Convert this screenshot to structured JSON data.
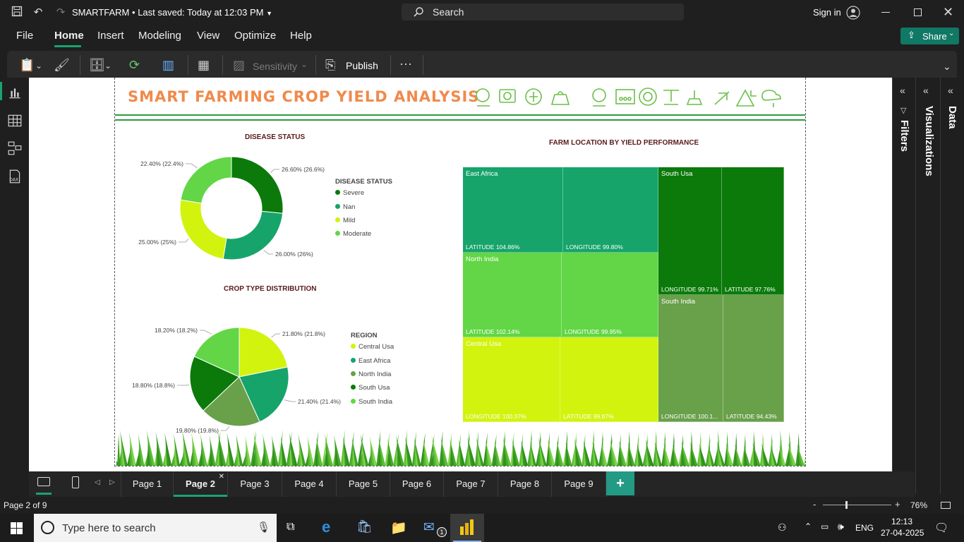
{
  "window": {
    "doc_title": "SMARTFARM",
    "saved_status": "Last saved: Today at 12:03 PM",
    "search_label": "Search",
    "signin_label": "Sign in"
  },
  "menu": {
    "items": [
      "File",
      "Home",
      "Insert",
      "Modeling",
      "View",
      "Optimize",
      "Help"
    ],
    "share_label": "Share"
  },
  "ribbon": {
    "sensitivity_label": "Sensitivity",
    "publish_label": "Publish",
    "more_label": "···"
  },
  "panes": {
    "filters": "Filters",
    "visualizations": "Visualizations",
    "data": "Data"
  },
  "report": {
    "title": "SMART FARMING CROP YIELD ANALYSIS",
    "disease": {
      "title": "DISEASE STATUS",
      "legend_title": "DISEASE STATUS",
      "slices": [
        {
          "name": "Severe",
          "value": 26.6,
          "label": "26.60% (26.6%)",
          "color": "#0b7a0b"
        },
        {
          "name": "Nan",
          "value": 26.0,
          "label": "26.00% (26%)",
          "color": "#16a46a"
        },
        {
          "name": "Mild",
          "value": 25.0,
          "label": "25.00% (25%)",
          "color": "#d2f30e"
        },
        {
          "name": "Moderate",
          "value": 22.4,
          "label": "22.40% (22.4%)",
          "color": "#62d646"
        }
      ]
    },
    "crop": {
      "title": "CROP TYPE DISTRIBUTION",
      "legend_title": "REGION",
      "slices": [
        {
          "name": "Central Usa",
          "value": 21.8,
          "label": "21.80% (21.8%)",
          "color": "#d2f30e"
        },
        {
          "name": "East Africa",
          "value": 21.4,
          "label": "21.40% (21.4%)",
          "color": "#16a46a"
        },
        {
          "name": "North India",
          "value": 19.8,
          "label": "19.80% (19.8%)",
          "color": "#69a04a"
        },
        {
          "name": "South Usa",
          "value": 18.8,
          "label": "18.80% (18.8%)",
          "color": "#0b7a0b"
        },
        {
          "name": "South India",
          "value": 18.2,
          "label": "18.20% (18.2%)",
          "color": "#62d646"
        }
      ]
    },
    "treemap": {
      "title": "FARM LOCATION BY YIELD PERFORMANCE",
      "groups": {
        "east_africa": "East Africa",
        "north_india": "North India",
        "central_usa": "Central Usa",
        "south_usa": "South Usa",
        "south_india": "South India"
      },
      "labels": {
        "ea_lat": "LATITUDE 104.86%",
        "ea_lon": "LONGITUDE 99.80%",
        "ni_lat": "LATITUDE 102.14%",
        "ni_lon": "LONGITUDE 99.95%",
        "cu_lon": "LONGITUDE 100.37%",
        "cu_lat": "LATITUDE 99.87%",
        "su_lon": "LONGITUDE 99.71%",
        "su_lat": "LATITUDE 97.76%",
        "si_lon": "LONGITUDE 100.1...",
        "si_lat": "LATITUDE 94.43%"
      },
      "colors": {
        "east_africa": "#16a46a",
        "north_india": "#62d646",
        "central_usa": "#d2f30e",
        "south_usa": "#0b7a0b",
        "south_india": "#69a04a"
      }
    }
  },
  "pages": {
    "tabs": [
      "Page 1",
      "Page 2",
      "Page 3",
      "Page 4",
      "Page 5",
      "Page 6",
      "Page 7",
      "Page 8",
      "Page 9"
    ],
    "active": "Page 2",
    "add_label": "+"
  },
  "status": {
    "page_indicator": "Page 2 of 9",
    "zoom": "76%"
  },
  "taskbar": {
    "search_placeholder": "Type here to search",
    "language": "ENG",
    "time": "12:13",
    "date": "27-04-2025",
    "mail_badge": "1"
  }
}
